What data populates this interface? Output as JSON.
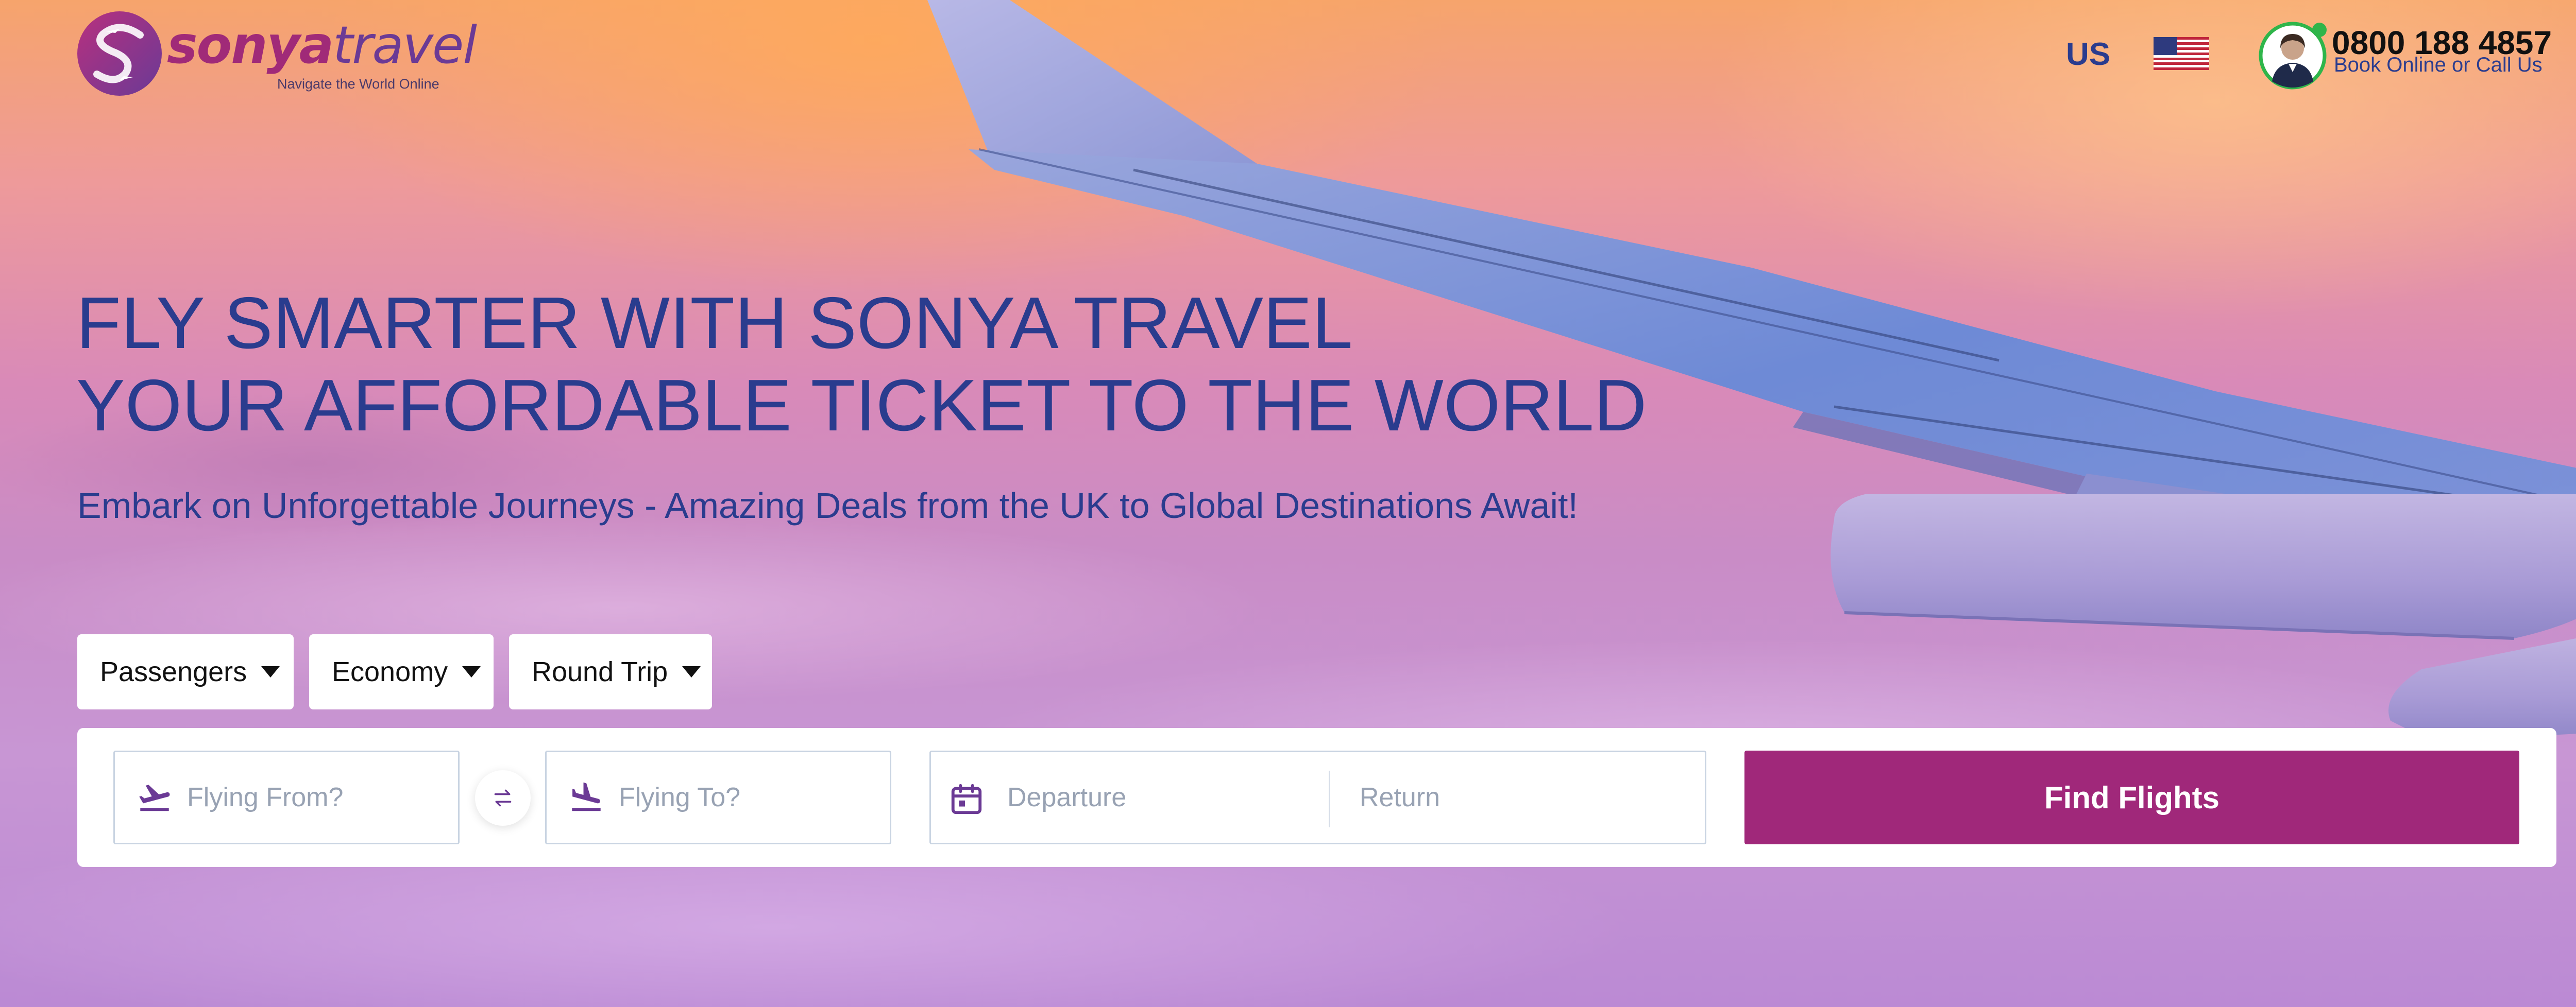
{
  "header": {
    "logo": {
      "brand_part1": "sonya",
      "brand_part2": "travel",
      "tagline": "Navigate the World Online"
    },
    "locale": "US",
    "flag_icon": "us-flag-icon",
    "phone": {
      "number": "0800 188 4857",
      "subtitle": "Book Online or Call Us"
    }
  },
  "hero": {
    "headline_line1": "FLY SMARTER WITH SONYA TRAVEL",
    "headline_line2": "YOUR AFFORDABLE TICKET TO THE WORLD",
    "subheadline": "Embark on Unforgettable Journeys - Amazing Deals from the UK to Global Destinations Await!"
  },
  "search": {
    "options": {
      "passengers": "Passengers",
      "cabin_class": "Economy",
      "trip_type": "Round Trip"
    },
    "from_placeholder": "Flying From?",
    "to_placeholder": "Flying To?",
    "departure_placeholder": "Departure",
    "return_placeholder": "Return",
    "submit_label": "Find Flights"
  },
  "colors": {
    "brand_magenta": "#a0287a",
    "brand_purple": "#6b3a95",
    "heading_blue": "#2a3c8e",
    "placeholder_gray": "#98a2b3"
  }
}
